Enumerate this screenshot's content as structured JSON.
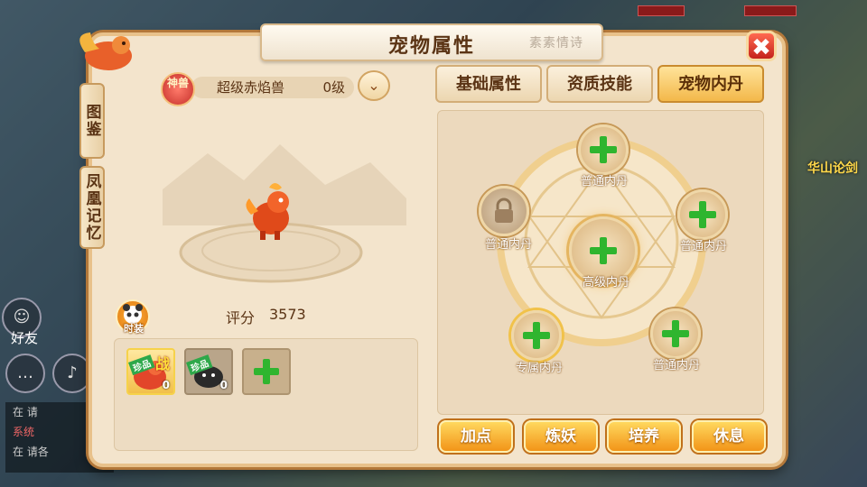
{
  "background": {
    "friend_label": "好友",
    "right_label": "华山论剑",
    "chat_lines": [
      "在",
      "系统",
      "在"
    ],
    "chat_suffix": [
      "请",
      "",
      "请各"
    ]
  },
  "window": {
    "title": "宠物属性",
    "title_decoration": "素素情诗",
    "close_icon": "✖"
  },
  "side_tabs": [
    {
      "label": "图鉴"
    },
    {
      "label": "凤凰记忆"
    }
  ],
  "pet": {
    "badge": "神兽",
    "name": "超级赤焰兽",
    "level": "0级",
    "score_label": "评分",
    "score_value": "3573",
    "costume_label": "时装"
  },
  "pet_slots": [
    {
      "tag": "珍品",
      "fight": "战",
      "count": "0"
    },
    {
      "tag": "珍品",
      "count": "0"
    },
    {
      "type": "add"
    }
  ],
  "tabs": [
    {
      "label": "基础属性",
      "active": false
    },
    {
      "label": "资质技能",
      "active": false
    },
    {
      "label": "宠物内丹",
      "active": true
    }
  ],
  "inner_pills": {
    "top": "普通内丹",
    "left": "普通内丹",
    "right": "普通内丹",
    "center": "高级内丹",
    "bottom_left": "专属内丹",
    "bottom_right": "普通内丹"
  },
  "actions": [
    "加点",
    "炼妖",
    "培养",
    "休息"
  ],
  "colors": {
    "accent": "#f3b84a",
    "plus_green": "#2fb52f",
    "close_red": "#d8302a"
  }
}
